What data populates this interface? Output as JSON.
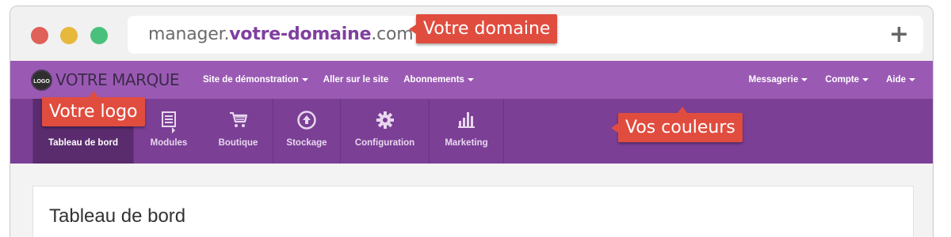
{
  "browser": {
    "url_prefix": "manager.",
    "url_domain": "votre-domaine",
    "url_suffix": ".com",
    "new_tab_symbol": "+"
  },
  "callouts": {
    "domain": "Votre domaine",
    "logo": "Votre logo",
    "colors": "Vos couleurs"
  },
  "brand": {
    "logo_text": "LOGO",
    "name": "VOTRE MARQUE"
  },
  "topnav": {
    "left": [
      {
        "label": "Site de démonstration",
        "dropdown": true
      },
      {
        "label": "Aller sur le site",
        "dropdown": false
      },
      {
        "label": "Abonnements",
        "dropdown": true
      }
    ],
    "right": [
      {
        "label": "Messagerie",
        "dropdown": true
      },
      {
        "label": "Compte",
        "dropdown": true
      },
      {
        "label": "Aide",
        "dropdown": true
      }
    ]
  },
  "tabs": [
    {
      "label": "Tableau de bord",
      "icon": "dashboard-icon",
      "active": true
    },
    {
      "label": "Modules",
      "icon": "modules-icon",
      "active": false
    },
    {
      "label": "Boutique",
      "icon": "cart-icon",
      "active": false
    },
    {
      "label": "Stockage",
      "icon": "upload-circle-icon",
      "active": false
    },
    {
      "label": "Configuration",
      "icon": "gear-icon",
      "active": false
    },
    {
      "label": "Marketing",
      "icon": "bar-chart-icon",
      "active": false
    }
  ],
  "page": {
    "title": "Tableau de bord"
  },
  "colors": {
    "topnav": "#9a5ab4",
    "subnav": "#7b3f95",
    "active_tab": "#5a2c6e",
    "callout": "#e04d3f",
    "domain_text": "#7f3fa0"
  }
}
